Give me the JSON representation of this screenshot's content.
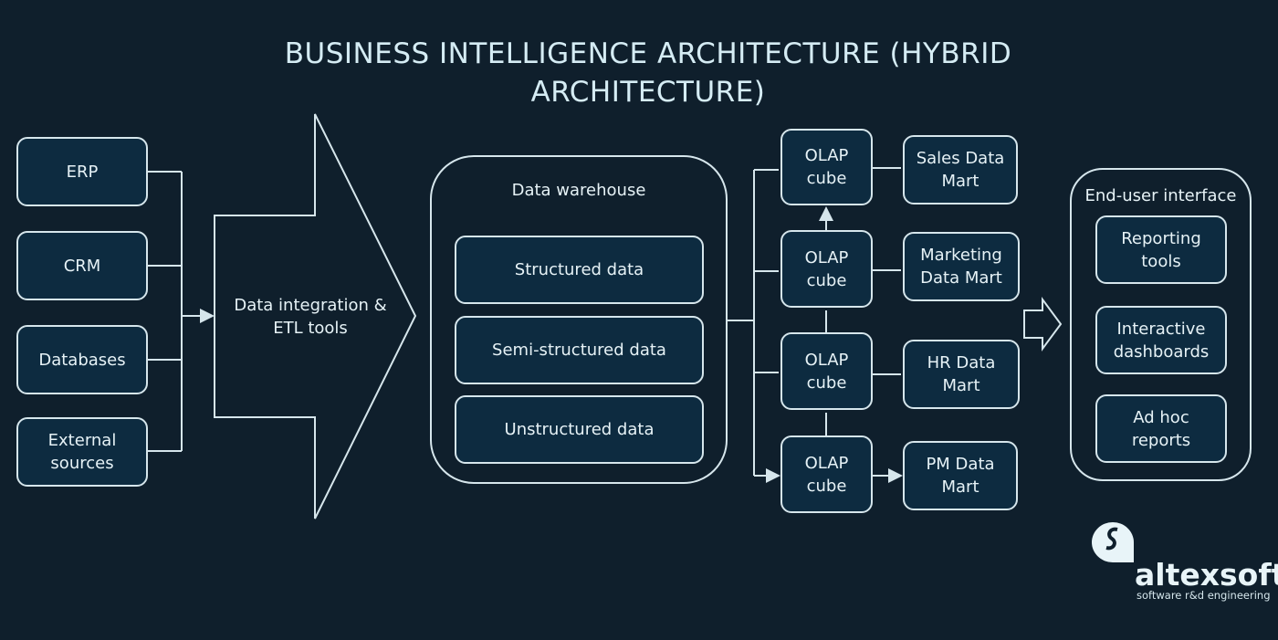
{
  "title": "BUSINESS INTELLIGENCE ARCHITECTURE (HYBRID ARCHITECTURE)",
  "sources": [
    "ERP",
    "CRM",
    "Databases",
    "External\nsources"
  ],
  "etl": "Data integration &\nETL tools",
  "warehouse": {
    "title": "Data warehouse",
    "items": [
      "Structured data",
      "Semi-structured data",
      "Unstructured data"
    ]
  },
  "olap": [
    "OLAP\ncube",
    "OLAP\ncube",
    "OLAP\ncube",
    "OLAP\ncube"
  ],
  "marts": [
    "Sales Data\nMart",
    "Marketing\nData Mart",
    "HR Data\nMart",
    "PM Data\nMart"
  ],
  "end_user": {
    "title": "End-user interface",
    "items": [
      "Reporting\ntools",
      "Interactive\ndashboards",
      "Ad hoc\nreports"
    ]
  },
  "logo": {
    "name": "altexsoft",
    "tagline": "software r&d engineering"
  },
  "colors": {
    "background": "#0f1f2c",
    "box": "#0d2b40",
    "stroke": "#d6e6ec"
  }
}
